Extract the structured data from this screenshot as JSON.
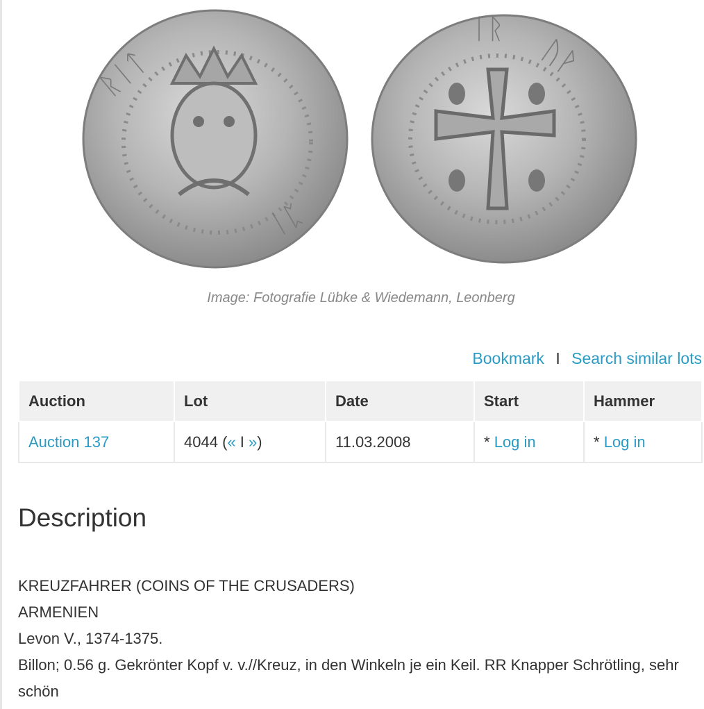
{
  "image_caption": "Image: Fotografie Lübke & Wiedemann, Leonberg",
  "actions": {
    "bookmark": "Bookmark",
    "separator": "I",
    "search_similar": "Search similar lots"
  },
  "table": {
    "headers": {
      "auction": "Auction",
      "lot": "Lot",
      "date": "Date",
      "start": "Start",
      "hammer": "Hammer"
    },
    "row": {
      "auction": "Auction 137",
      "lot_number": "4044",
      "lot_prev": "«",
      "lot_sep": "I",
      "lot_next": "»",
      "date": "11.03.2008",
      "start_prefix": "*",
      "start_link": "Log in",
      "hammer_prefix": "*",
      "hammer_link": "Log in"
    }
  },
  "description": {
    "title": "Description",
    "lines": [
      "KREUZFAHRER (COINS OF THE CRUSADERS)",
      "ARMENIEN",
      "Levon V., 1374-1375.",
      "Billon; 0.56 g. Gekrönter Kopf v. v.//Kreuz, in den Winkeln je ein Keil. RR Knapper Schrötling, sehr schön"
    ]
  }
}
